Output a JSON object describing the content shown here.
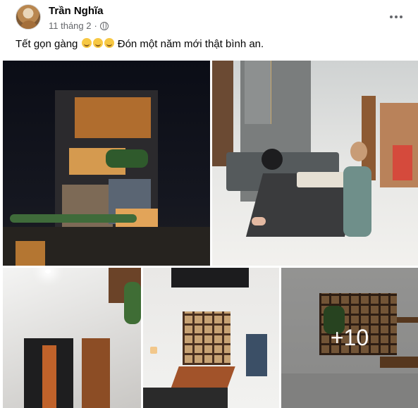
{
  "post": {
    "author": "Trần Nghĩa",
    "date": "11 tháng 2",
    "separator": "·",
    "caption_text": "Tết gọn gàng",
    "caption_rest": "Đón một năm mới thật bình an.",
    "emoji_icons": [
      "grinning-face-emoji",
      "grinning-face-emoji",
      "grinning-face-emoji"
    ],
    "privacy_icon": "globe-icon",
    "more_icon": "more-options-icon"
  },
  "photos": {
    "remaining_count_label": "+10"
  },
  "colors": {
    "text": "#050505",
    "meta": "#65676b",
    "overlay": "rgba(0,0,0,0.38)"
  }
}
